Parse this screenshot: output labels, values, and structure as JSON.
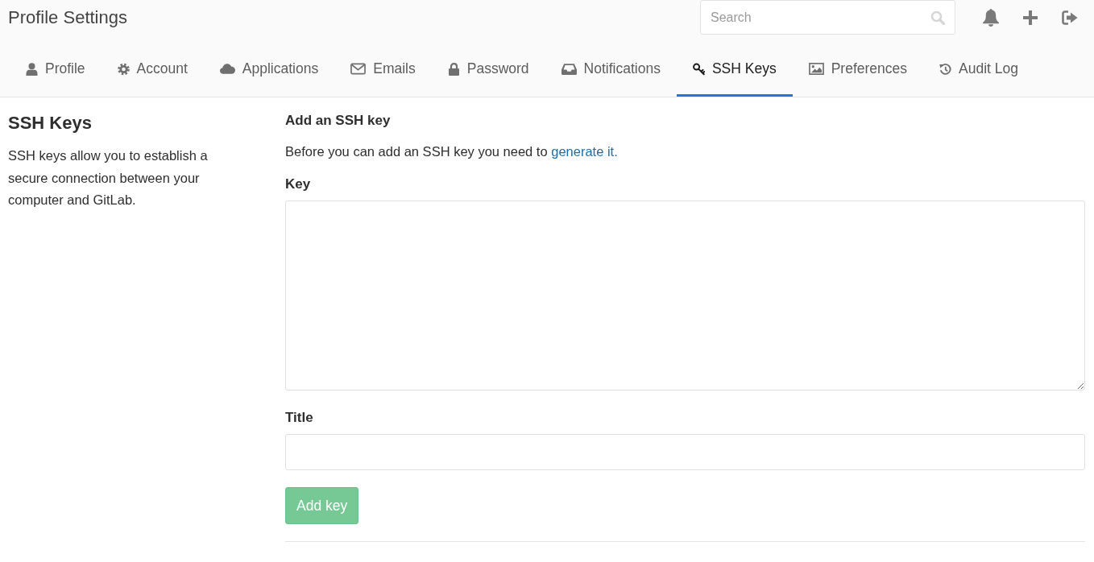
{
  "header": {
    "title": "Profile Settings",
    "search": {
      "placeholder": "Search"
    }
  },
  "tabs": [
    {
      "label": "Profile",
      "selected": false
    },
    {
      "label": "Account",
      "selected": false
    },
    {
      "label": "Applications",
      "selected": false
    },
    {
      "label": "Emails",
      "selected": false
    },
    {
      "label": "Password",
      "selected": false
    },
    {
      "label": "Notifications",
      "selected": false
    },
    {
      "label": "SSH Keys",
      "selected": true
    },
    {
      "label": "Preferences",
      "selected": false
    },
    {
      "label": "Audit Log",
      "selected": false
    }
  ],
  "sidebar": {
    "title": "SSH Keys",
    "description": "SSH keys allow you to establish a secure connection between your computer and GitLab."
  },
  "form": {
    "heading": "Add an SSH key",
    "intro": "Before you can add an SSH key you need to",
    "intro_link": "generate it.",
    "fields": [
      {
        "label": "Key",
        "kind": "textarea"
      },
      {
        "label": "Title",
        "kind": "input"
      }
    ],
    "submit": {
      "label": "Add key",
      "disabled": true
    }
  }
}
